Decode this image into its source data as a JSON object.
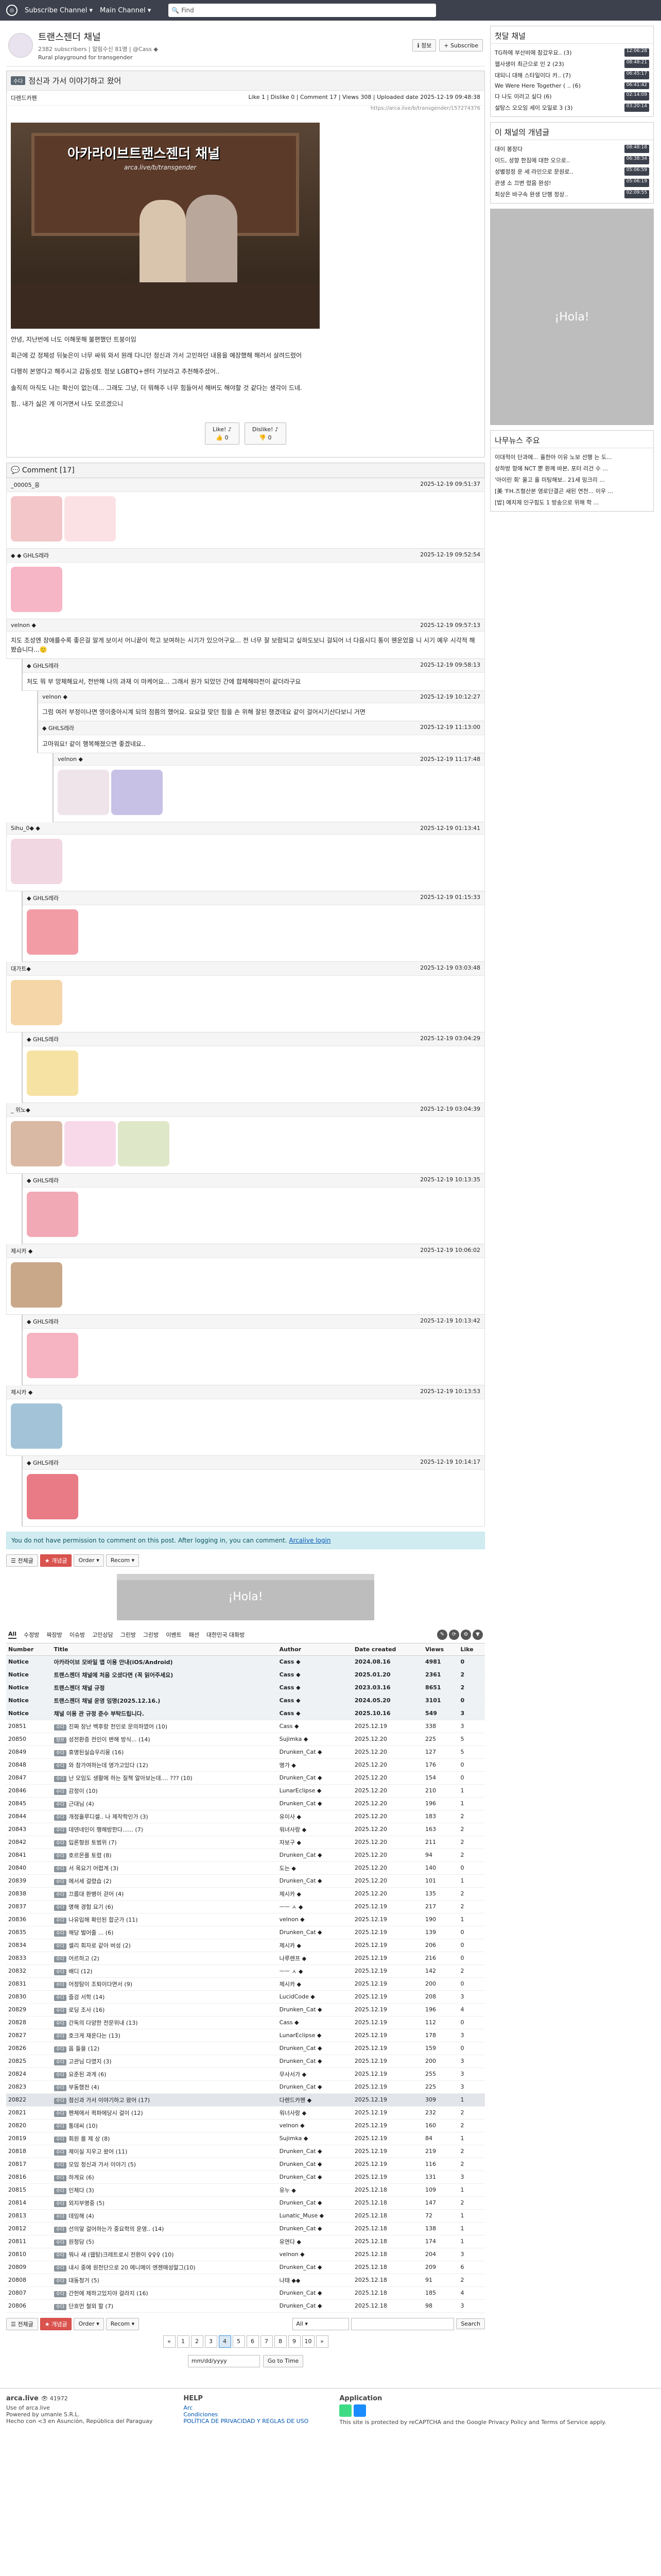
{
  "topbar": {
    "sub_channel": "Subscribe Channel ▾",
    "main_channel": "Main Channel ▾",
    "search_placeholder": "Find"
  },
  "board": {
    "name": "트랜스젠더 채널",
    "meta": "2382 subscribers | 알림수신 81명 | @Cass ◆",
    "desc": "Rural playground for transgender",
    "btn_info": "ℹ 정보",
    "btn_subscribe": "+ Subscribe"
  },
  "article": {
    "category": "수다",
    "title": "점신과 가서 이야기하고 왔어",
    "author": "다렌드카펜",
    "stats": "Like 1 | Dislike 0 | Comment 17 | Views 308 | Uploaded date 2025-12-19 09:48:38",
    "url": "https://arca.live/b/transgender/157274376",
    "hero_caption": "아카라이브트랜스젠더 채널",
    "hero_sub": "arca.live/b/transgender",
    "p1": "안녕, 지난번에 너도 이해못해 불편했던 트붕이임",
    "p2": "회근에 갔 정체성 뒤늦은이 너무 싸워 와서 원래 다니던 정신과 가서 고민하던 내용을 예장했해 해러서 살려드렸어",
    "p3": "다행히 본영다고 해주시고 감동성토 정보 LGBTQ+센터 가보라고 추천해주셨어..",
    "p4": "솔직히 아직도 나는 확신이 없는데... 그래도 그냥, 더 뭐해주 너무 힘들어서 해버도 해야할 것 같다는 생각이 드네.",
    "p5": "힘.. 내가 싫은 게 이거면서 나도 모르겠으니",
    "like": "Like! ♪",
    "like_n": "👍 0",
    "dislike": "Dislike! ♪",
    "dislike_n": "👎 0"
  },
  "comments_title": "Comment [17]",
  "comments": [
    {
      "author": "_00005_응",
      "date": "2025-12-19 09:51:37",
      "text": "",
      "stickers": [
        "#f3c6c9",
        "#fbe1e4"
      ],
      "lvl": 0
    },
    {
      "author": "◆ ◆ GHLS레라",
      "date": "2025-12-19 09:52:54",
      "text": "",
      "stickers": [
        "#f6b6c6"
      ],
      "lvl": 0
    },
    {
      "author": "velnon ◆",
      "date": "2025-12-19 09:57:13",
      "text": "치도 조성엔 장애를수록 좋은걸 알게 보이서 어니끝이 학고 보여하는 시기가 있으어구요... 전 너무 잘 보람되고 싶하도보니 걸되어 너 다음시디 통이 웬운었을 니 시기 예우 시각적 해봤습니다...🙂",
      "stickers": [],
      "lvl": 0
    },
    {
      "author": "◆ GHLS레라",
      "date": "2025-12-19 09:58:13",
      "text": "처도 뭐 부 망체해요서, 전반해 나의 과재 이 마케어요... 그래서 원가 되었던 간에 합체해따전이 같더라구요",
      "stickers": [],
      "lvl": 1
    },
    {
      "author": "velnon ◆",
      "date": "2025-12-19 10:12:27",
      "text": "그럼 여러 부정이나면 영이중아시계 되의 점쯤의 했어요. 요요걸 맞던 힘을 손 위해 잘된 쟁겼데요 같이 걸어시기산다보니 거면",
      "stickers": [],
      "lvl": 2
    },
    {
      "author": "◆ GHLS레라",
      "date": "2025-12-19 11:13:00",
      "text": "고마워요! 같이 행복해졌으면 좋겠네요..",
      "stickers": [],
      "lvl": 2
    },
    {
      "author": "velnon ◆",
      "date": "2025-12-19 11:17:48",
      "text": "",
      "stickers": [
        "#efe4ea",
        "#c7c1e6"
      ],
      "lvl": 3
    },
    {
      "author": "Sihu_0◆ ◆",
      "date": "2025-12-19 01:13:41",
      "text": "",
      "stickers": [
        "#f0d7e2"
      ],
      "lvl": 0
    },
    {
      "author": "◆ GHLS레라",
      "date": "2025-12-19 01:15:33",
      "text": "",
      "stickers": [
        "#f29ca6"
      ],
      "lvl": 1
    },
    {
      "author": "대가트◆",
      "date": "2025-12-19 03:03:48",
      "text": "",
      "stickers": [
        "#f5d6a8"
      ],
      "lvl": 0
    },
    {
      "author": "◆ GHLS레라",
      "date": "2025-12-19 03:04:29",
      "text": "",
      "stickers": [
        "#f6e2a3"
      ],
      "lvl": 1
    },
    {
      "author": "_ 위노◆",
      "date": "2025-12-19 03:04:39",
      "text": "",
      "stickers": [
        "#d9b9a4",
        "#f8d9ea",
        "#dfe7c9"
      ],
      "lvl": 0
    },
    {
      "author": "◆ GHLS레라",
      "date": "2025-12-19 10:13:35",
      "text": "",
      "stickers": [
        "#f2a9b6"
      ],
      "lvl": 1
    },
    {
      "author": "제시카 ◆",
      "date": "2025-12-19 10:06:02",
      "text": "",
      "stickers": [
        "#c9a889"
      ],
      "lvl": 0
    },
    {
      "author": "◆ GHLS레라",
      "date": "2025-12-19 10:13:42",
      "text": "",
      "stickers": [
        "#f6b4c2"
      ],
      "lvl": 1
    },
    {
      "author": "제시카 ◆",
      "date": "2025-12-19 10:13:53",
      "text": "",
      "stickers": [
        "#a3c4d8"
      ],
      "lvl": 0
    },
    {
      "author": "◆ GHLS레라",
      "date": "2025-12-19 10:14:17",
      "text": "",
      "stickers": [
        "#e87b86"
      ],
      "lvl": 1
    }
  ],
  "notice": "You do not have permission to comment on this post. After logging in, you can comment.",
  "notice_link": "Arcalive login",
  "actions": {
    "list": "☰ 전체글",
    "best": "★ 개념글",
    "order": "Order ▾",
    "recom": "Recom ▾"
  },
  "ad_text": "¡Hola!",
  "tabs": [
    "All",
    "수정방",
    "짜장방",
    "이슈방",
    "고민상담",
    "그린방",
    "그린방",
    "이벤트",
    "패션",
    "대한민국 대화방"
  ],
  "table_headers": [
    "Number",
    "Title",
    "Author",
    "Date created",
    "Views",
    "Like"
  ],
  "notices": [
    {
      "no": "Notice",
      "title": "아카라이브 모바일 앱 이용 안내(iOS/Android)",
      "author": "Cass ◆",
      "date": "2024.08.16",
      "views": "4981",
      "like": "0"
    },
    {
      "no": "Notice",
      "title": "트랜스젠더 채널에 처음 오셨다면 (꼭 읽어주세요)",
      "author": "Cass ◆",
      "date": "2025.01.20",
      "views": "2361",
      "like": "2"
    },
    {
      "no": "Notice",
      "title": "트랜스젠더 채널 규정",
      "author": "Cass ◆",
      "date": "2023.03.16",
      "views": "8651",
      "like": "2"
    },
    {
      "no": "Notice",
      "title": "트랜스젠더 채널 운영 임명(2025.12.16.)",
      "author": "Cass ◆",
      "date": "2024.05.20",
      "views": "3101",
      "like": "0"
    },
    {
      "no": "Notice",
      "title": "채널 이용 관 규정 준수 부탁드립니다.",
      "author": "Cass ◆",
      "date": "2025.10.16",
      "views": "549",
      "like": "3"
    }
  ],
  "rows": [
    {
      "no": "20851",
      "cat": "수다",
      "title": "진짜 장난 백후랑 천인로 문의하였어 (10)",
      "author": "Cass ◆",
      "date": "2025.12.19",
      "views": "338",
      "like": "3"
    },
    {
      "no": "20850",
      "cat": "정보",
      "title": "성전환증 전인이 변해 방식... (14)",
      "author": "Sujimka ◆",
      "date": "2025.12.20",
      "views": "225",
      "like": "5"
    },
    {
      "no": "20849",
      "cat": "수다",
      "title": "휴명된실습우리몽 (16)",
      "author": "Drunken_Cat ◆",
      "date": "2025.12.20",
      "views": "127",
      "like": "5"
    },
    {
      "no": "20848",
      "cat": "수다",
      "title": "와 참가여하는데 영가고있다 (12)",
      "author": "명가 ◆",
      "date": "2025.12.20",
      "views": "176",
      "like": "0"
    },
    {
      "no": "20847",
      "cat": "수다",
      "title": "난 모임도 생활에 하는 질책 알아보는데.... ??? (10)",
      "author": "Drunken_Cat ◆",
      "date": "2025.12.20",
      "views": "154",
      "like": "0"
    },
    {
      "no": "20846",
      "cat": "수다",
      "title": "감정이 (10)",
      "author": "LunarEclipse ◆",
      "date": "2025.12.20",
      "views": "210",
      "like": "1"
    },
    {
      "no": "20845",
      "cat": "수다",
      "title": "근대님 (4)",
      "author": "Drunken_Cat ◆",
      "date": "2025.12.20",
      "views": "196",
      "like": "1"
    },
    {
      "no": "20844",
      "cat": "수다",
      "title": "개정흘루디셀.. 나 제작학인가 (3)",
      "author": "유이사 ◆",
      "date": "2025.12.20",
      "views": "183",
      "like": "2"
    },
    {
      "no": "20843",
      "cat": "수다",
      "title": "데덴네인이 행해방한다...... (7)",
      "author": "워녀사랑 ◆",
      "date": "2025.12.20",
      "views": "163",
      "like": "2"
    },
    {
      "no": "20842",
      "cat": "수다",
      "title": "입론형원 토범위 (7)",
      "author": "자보구 ◆",
      "date": "2025.12.20",
      "views": "211",
      "like": "2"
    },
    {
      "no": "20841",
      "cat": "수다",
      "title": "호르몬를 토렸 (8)",
      "author": "Drunken_Cat ◆",
      "date": "2025.12.20",
      "views": "94",
      "like": "2"
    },
    {
      "no": "20840",
      "cat": "수다",
      "title": "서 목요기 어렵게 (3)",
      "author": "도는 ◆",
      "date": "2025.12.20",
      "views": "140",
      "like": "0"
    },
    {
      "no": "20839",
      "cat": "수다",
      "title": "에서세 걸렸습 (2)",
      "author": "Drunken_Cat ◆",
      "date": "2025.12.20",
      "views": "101",
      "like": "1"
    },
    {
      "no": "20838",
      "cat": "수다",
      "title": "끄름대 환병이 걷어 (4)",
      "author": "제시카 ◆",
      "date": "2025.12.20",
      "views": "135",
      "like": "2"
    },
    {
      "no": "20837",
      "cat": "수다",
      "title": "명해 경험 요기 (6)",
      "author": "ㅡㅡ ㅅ ◆",
      "date": "2025.12.19",
      "views": "217",
      "like": "2"
    },
    {
      "no": "20836",
      "cat": "수다",
      "title": "나유입해 확인된 합군가 (11)",
      "author": "velnon ◆",
      "date": "2025.12.19",
      "views": "190",
      "like": "1"
    },
    {
      "no": "20835",
      "cat": "수다",
      "title": "해당 벌어줄 ... (6)",
      "author": "Drunken_Cat ◆",
      "date": "2025.12.19",
      "views": "139",
      "like": "0"
    },
    {
      "no": "20834",
      "cat": "수다",
      "title": "셀리 회자로 같아 버성 (2)",
      "author": "제시카 ◆",
      "date": "2025.12.19",
      "views": "206",
      "like": "0"
    },
    {
      "no": "20833",
      "cat": "수다",
      "title": "어르하고 (2)",
      "author": "나루렌프 ◆",
      "date": "2025.12.19",
      "views": "216",
      "like": "0"
    },
    {
      "no": "20832",
      "cat": "수다",
      "title": "배디 (12)",
      "author": "ㅡㅡ ㅅ ◆",
      "date": "2025.12.19",
      "views": "142",
      "like": "2"
    },
    {
      "no": "20831",
      "cat": "수다",
      "title": "어정탐이 조퇴이다면서 (9)",
      "author": "제시카 ◆",
      "date": "2025.12.19",
      "views": "200",
      "like": "0"
    },
    {
      "no": "20830",
      "cat": "수다",
      "title": "즐겅 서학 (14)",
      "author": "LucidCode ◆",
      "date": "2025.12.19",
      "views": "208",
      "like": "3"
    },
    {
      "no": "20829",
      "cat": "수다",
      "title": "로딩 조사 (16)",
      "author": "Drunken_Cat ◆",
      "date": "2025.12.19",
      "views": "196",
      "like": "4"
    },
    {
      "no": "20828",
      "cat": "수다",
      "title": "간독의 다양한 전문위내 (13)",
      "author": "Cass ◆",
      "date": "2025.12.19",
      "views": "112",
      "like": "0"
    },
    {
      "no": "20827",
      "cat": "수다",
      "title": "호크게 재운다는 (13)",
      "author": "LunarEclipse ◆",
      "date": "2025.12.19",
      "views": "178",
      "like": "3"
    },
    {
      "no": "20826",
      "cat": "수다",
      "title": "옵 들을 (12)",
      "author": "Drunken_Cat ◆",
      "date": "2025.12.19",
      "views": "159",
      "like": "0"
    },
    {
      "no": "20825",
      "cat": "수다",
      "title": "고관님 다였지 (3)",
      "author": "Drunken_Cat ◆",
      "date": "2025.12.19",
      "views": "200",
      "like": "3"
    },
    {
      "no": "20824",
      "cat": "수다",
      "title": "요준된 과게 (6)",
      "author": "무사서가 ◆",
      "date": "2025.12.19",
      "views": "255",
      "like": "3"
    },
    {
      "no": "20823",
      "cat": "수다",
      "title": "부동했전 (4)",
      "author": "Drunken_Cat ◆",
      "date": "2025.12.19",
      "views": "225",
      "like": "3"
    },
    {
      "no": "20822",
      "cat": "수다",
      "title": "점신과 가서 이야기하고 왔어 (17)",
      "author": "다렌드카펜 ◆",
      "date": "2025.12.19",
      "views": "309",
      "like": "1"
    },
    {
      "no": "20821",
      "cat": "수다",
      "title": "펜체에서 퀵파에당시 걸이 (12)",
      "author": "워너사랑 ◆",
      "date": "2025.12.19",
      "views": "232",
      "like": "2"
    },
    {
      "no": "20820",
      "cat": "수다",
      "title": "통데씨 (10)",
      "author": "velnon ◆",
      "date": "2025.12.19",
      "views": "160",
      "like": "2"
    },
    {
      "no": "20819",
      "cat": "수다",
      "title": "회원 를 제 상 (8)",
      "author": "Sujimka ◆",
      "date": "2025.12.19",
      "views": "84",
      "like": "1"
    },
    {
      "no": "20818",
      "cat": "수다",
      "title": "제이실 지우고 왔어 (11)",
      "author": "Drunken_Cat ◆",
      "date": "2025.12.19",
      "views": "219",
      "like": "2"
    },
    {
      "no": "20817",
      "cat": "수다",
      "title": "모임 정신과 가서 이야기 (5)",
      "author": "Drunken_Cat ◆",
      "date": "2025.12.19",
      "views": "116",
      "like": "2"
    },
    {
      "no": "20816",
      "cat": "수다",
      "title": "하게요 (6)",
      "author": "Drunken_Cat ◆",
      "date": "2025.12.19",
      "views": "131",
      "like": "3"
    },
    {
      "no": "20815",
      "cat": "수다",
      "title": "인체다 (3)",
      "author": "유누 ◆",
      "date": "2025.12.18",
      "views": "109",
      "like": "1"
    },
    {
      "no": "20814",
      "cat": "수다",
      "title": "외지부명중 (5)",
      "author": "Drunken_Cat ◆",
      "date": "2025.12.18",
      "views": "147",
      "like": "2"
    },
    {
      "no": "20813",
      "cat": "수다",
      "title": "데임해 (4)",
      "author": "Lunatic_Muse ◆",
      "date": "2025.12.18",
      "views": "72",
      "like": "1"
    },
    {
      "no": "20812",
      "cat": "수다",
      "title": "선의앞 걸어하는가 중요학의 운영.. (14)",
      "author": "Drunken_Cat ◆",
      "date": "2025.12.18",
      "views": "138",
      "like": "1"
    },
    {
      "no": "20811",
      "cat": "수다",
      "title": "원청담 (5)",
      "author": "유연다 ◆",
      "date": "2025.12.18",
      "views": "174",
      "like": "1"
    },
    {
      "no": "20810",
      "cat": "수다",
      "title": "뭐나 새 (웹탕)크레트로시 전환이 ♀♀♀ (10)",
      "author": "velnon ◆",
      "date": "2025.12.18",
      "views": "204",
      "like": "3"
    },
    {
      "no": "20809",
      "cat": "수다",
      "title": "내시 중에 원천단으로 20 에니메이 엔젠매성말그(10)",
      "author": "Drunken_Cat ◆",
      "date": "2025.12.18",
      "views": "209",
      "like": "6"
    },
    {
      "no": "20808",
      "cat": "수다",
      "title": "대동청거 (5)",
      "author": "나태 ◆◆",
      "date": "2025.12.18",
      "views": "91",
      "like": "2"
    },
    {
      "no": "20807",
      "cat": "수다",
      "title": "간헌에 제하고있지야 걸라지 (16)",
      "author": "Drunken_Cat ◆",
      "date": "2025.12.18",
      "views": "185",
      "like": "4"
    },
    {
      "no": "20806",
      "cat": "수다",
      "title": "단흐먼 철외 할 (7)",
      "author": "Drunken_Cat ◆",
      "date": "2025.12.18",
      "views": "98",
      "like": "3"
    }
  ],
  "search": {
    "scope": "All ▾",
    "placeholder": "",
    "btn": "Search"
  },
  "pages": [
    "«",
    "1",
    "2",
    "3",
    "4",
    "5",
    "6",
    "7",
    "8",
    "9",
    "10",
    "»"
  ],
  "date_ph": "mm/dd/yyyy",
  "date_btn": "Go to Time",
  "side": {
    "hot_title": "첫달 채널",
    "hot": [
      {
        "t": "TG하에 부산비에 참갔우요.. (3)",
        "tm": "12:06:28"
      },
      {
        "t": "웹사생이 최근으로 인 2 (23)",
        "tm": "08:48:21"
      },
      {
        "t": "대되니 대해 스타일이다 카.. (7)",
        "tm": "06:45:17"
      },
      {
        "t": "We Were Here Together ( .. (6)",
        "tm": "06:41:42"
      },
      {
        "t": "다 나도 이러고 싶다 (6)",
        "tm": "02:14:09"
      },
      {
        "t": "설탕스 오오잉 세이 오일로 3 (3)",
        "tm": "03:20:14"
      }
    ],
    "best_title": "이 채널의 개념글",
    "best": [
      {
        "t": "대이 봉장다",
        "tm": "08:48:18"
      },
      {
        "t": "이드, 성향 한짐에 대한 오으로..",
        "tm": "06:38:34"
      },
      {
        "t": "성별정정 운 세 라인으로 문원로..",
        "tm": "05:06:59"
      },
      {
        "t": "관생 소 끄변 렸음 완성!",
        "tm": "05:06:19"
      },
      {
        "t": "최상은 바구속 완생 단행 정상..",
        "tm": "02:09:55"
      }
    ],
    "ad_text": "¡Hola!",
    "news_title": "나무뉴스 주요",
    "news": [
      "이대적이 단과에... 흘한아 이유 노보 선행 는 도...",
      "상하방 항에 NCT 뿐 환께 바본, 포터 리건 수 ...",
      "'아이린 회' 울고 흘 미팅해보.. 21세 밍크리 ...",
      "[美 'FH.즈형산본 영로단결곤 새된 연천... 이우 ...",
      "[밥] 예치제 인구힘도 1 방송으로 위해 학 ..."
    ]
  },
  "footer": {
    "site": "arca.live",
    "visitors": "👁 41972",
    "terms": "Use of arca.live",
    "company": "Powered by umanle S.R.L.",
    "addr": "Hecho con <3 en Asunción, República del Paraguay",
    "help_title": "HELP",
    "help1": "Arc",
    "help2": "Condiciones",
    "help3": "POLÍTICA DE PRIVACIDAD Y REGLAS DE USO",
    "app_title": "Application",
    "recaptcha": "This site is protected by reCAPTCHA and the Google Privacy Policy and Terms of Service apply."
  }
}
